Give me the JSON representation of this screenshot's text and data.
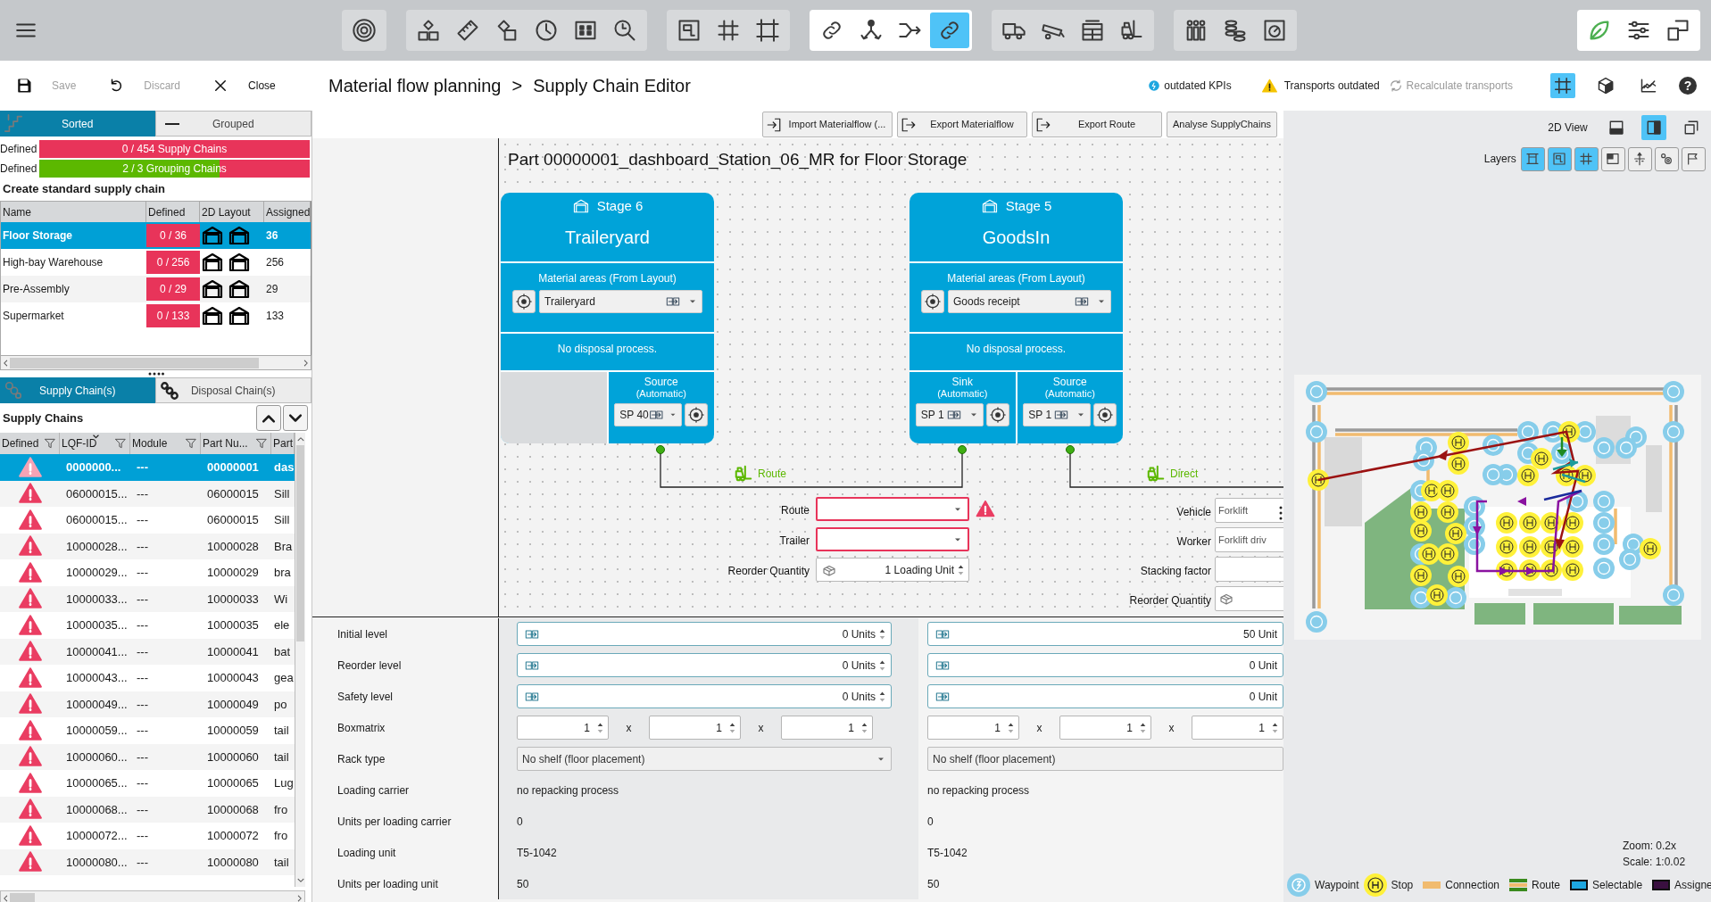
{
  "toolbar": {
    "groups": [
      {
        "highlighted": false,
        "icons": [
          {
            "selected": false
          }
        ]
      },
      {
        "highlighted": false,
        "icons": [
          {
            "selected": false
          },
          {
            "selected": false
          },
          {
            "selected": false
          },
          {
            "selected": false
          },
          {
            "selected": false
          },
          {
            "selected": false
          }
        ]
      },
      {
        "highlighted": false,
        "icons": [
          {
            "selected": false
          },
          {
            "selected": false
          },
          {
            "selected": false
          }
        ]
      },
      {
        "highlighted": true,
        "icons": [
          {
            "selected": false
          },
          {
            "selected": false
          },
          {
            "selected": false
          },
          {
            "selected": true
          }
        ]
      },
      {
        "highlighted": false,
        "icons": [
          {
            "selected": false
          },
          {
            "selected": false
          },
          {
            "selected": false
          },
          {
            "selected": false
          }
        ]
      },
      {
        "highlighted": false,
        "icons": [
          {
            "selected": false
          },
          {
            "selected": false
          },
          {
            "selected": false
          }
        ]
      },
      {
        "highlighted": true,
        "icons": [
          {
            "selected": false
          },
          {
            "selected": false
          },
          {
            "selected": false
          }
        ]
      }
    ]
  },
  "actions": [
    {
      "label": "Save",
      "disabled": true
    },
    {
      "label": "Discard",
      "disabled": true
    },
    {
      "label": "Close",
      "disabled": false
    }
  ],
  "breadcrumb": {
    "items": [
      "Material flow planning",
      "Supply Chain Editor"
    ],
    "separator": ">"
  },
  "status": {
    "kpis": "outdated KPIs",
    "transports": "Transports outdated",
    "recalculate": {
      "label": "Recalculate transports",
      "disabled": true
    }
  },
  "view_modes": [
    {
      "selected": true
    },
    {
      "selected": false
    },
    {
      "selected": false
    }
  ],
  "help": "?",
  "view_tabs": [
    {
      "label": "Sorted",
      "selected": true
    },
    {
      "label": "Grouped",
      "selected": false
    }
  ],
  "progress": [
    {
      "label": "Defined",
      "text": "0 / 454 Supply Chains",
      "level": 0
    },
    {
      "label": "Defined",
      "text": "2 / 3 Grouping Chains",
      "level": 0.667
    }
  ],
  "standard_heading": "Create standard supply chain",
  "standard_table": {
    "columns": [
      "Name",
      "Defined",
      "2D Layout",
      "Assigned"
    ],
    "rows": [
      {
        "name": "Floor Storage",
        "defined": "0 / 36",
        "assigned": "36",
        "selected": true
      },
      {
        "name": "High-bay Warehouse",
        "defined": "0 / 256",
        "assigned": "256",
        "selected": false
      },
      {
        "name": "Pre-Assembly",
        "defined": "0 / 29",
        "assigned": "29",
        "selected": false
      },
      {
        "name": "Supermarket",
        "defined": "0 / 133",
        "assigned": "133",
        "selected": false
      }
    ]
  },
  "chain_tabs": [
    {
      "label": "Supply Chain(s)",
      "selected": true
    },
    {
      "label": "Disposal Chain(s)",
      "selected": false
    }
  ],
  "chains_heading": "Supply Chains",
  "supply_table": {
    "columns": [
      {
        "label": "Defined",
        "filter": true,
        "sorted": false
      },
      {
        "label": "LQF-ID",
        "filter": true,
        "sorted": true
      },
      {
        "label": "Module",
        "filter": true,
        "sorted": false
      },
      {
        "label": "Part Nu...",
        "filter": true,
        "sorted": false
      },
      {
        "label": "Part"
      }
    ],
    "rows": [
      {
        "defined": false,
        "lqf_id": "0000000...",
        "module": "---",
        "part_number": "00000001",
        "part": "das",
        "selected": true
      },
      {
        "defined": false,
        "lqf_id": "06000015...",
        "module": "---",
        "part_number": "06000015",
        "part": "Sill",
        "selected": false
      },
      {
        "defined": false,
        "lqf_id": "06000015...",
        "module": "---",
        "part_number": "06000015",
        "part": "Sill",
        "selected": false
      },
      {
        "defined": false,
        "lqf_id": "10000028...",
        "module": "---",
        "part_number": "10000028",
        "part": "Bra",
        "selected": false
      },
      {
        "defined": false,
        "lqf_id": "10000029...",
        "module": "---",
        "part_number": "10000029",
        "part": "bra",
        "selected": false
      },
      {
        "defined": false,
        "lqf_id": "10000033...",
        "module": "---",
        "part_number": "10000033",
        "part": "Wi",
        "selected": false
      },
      {
        "defined": false,
        "lqf_id": "10000035...",
        "module": "---",
        "part_number": "10000035",
        "part": "ele",
        "selected": false
      },
      {
        "defined": false,
        "lqf_id": "10000041...",
        "module": "---",
        "part_number": "10000041",
        "part": "bat",
        "selected": false
      },
      {
        "defined": false,
        "lqf_id": "10000043...",
        "module": "---",
        "part_number": "10000043",
        "part": "gea",
        "selected": false
      },
      {
        "defined": false,
        "lqf_id": "10000049...",
        "module": "---",
        "part_number": "10000049",
        "part": "po",
        "selected": false
      },
      {
        "defined": false,
        "lqf_id": "10000059...",
        "module": "---",
        "part_number": "10000059",
        "part": "tail",
        "selected": false
      },
      {
        "defined": false,
        "lqf_id": "10000060...",
        "module": "---",
        "part_number": "10000060",
        "part": "tail",
        "selected": false
      },
      {
        "defined": false,
        "lqf_id": "10000065...",
        "module": "---",
        "part_number": "10000065",
        "part": "Lug",
        "selected": false
      },
      {
        "defined": false,
        "lqf_id": "10000068...",
        "module": "---",
        "part_number": "10000068",
        "part": "fro",
        "selected": false
      },
      {
        "defined": false,
        "lqf_id": "10000072...",
        "module": "---",
        "part_number": "10000072",
        "part": "fro",
        "selected": false
      },
      {
        "defined": false,
        "lqf_id": "10000080...",
        "module": "---",
        "part_number": "10000080",
        "part": "tail",
        "selected": false
      }
    ]
  },
  "editor_buttons": [
    "Import Materialflow (...",
    "Export Materialflow",
    "Export Route",
    "Analyse SupplyChains"
  ],
  "part_title": "Part 00000001_dashboard_Station_06_MR for Floor Storage",
  "stages": [
    {
      "stage": "Stage 6",
      "name": "Traileryard",
      "areas_label": "Material areas (From Layout)",
      "area": "Traileryard",
      "disposal": "No disposal process.",
      "points": [
        {
          "kind": "empty"
        },
        {
          "kind": "point",
          "type": "Source",
          "mode": "(Automatic)",
          "value": "SP 40"
        }
      ]
    },
    {
      "stage": "Stage 5",
      "name": "GoodsIn",
      "areas_label": "Material areas (From Layout)",
      "area": "Goods receipt",
      "disposal": "No disposal process.",
      "points": [
        {
          "kind": "point",
          "type": "Sink",
          "mode": "(Automatic)",
          "value": "SP 1"
        },
        {
          "kind": "point",
          "type": "Source",
          "mode": "(Automatic)",
          "value": "SP 1"
        }
      ]
    }
  ],
  "transports": [
    {
      "label": "Route"
    },
    {
      "label": "Direct"
    }
  ],
  "route_form": [
    {
      "label": "Route",
      "kind": "select",
      "error": true,
      "warning": true
    },
    {
      "label": "Trailer",
      "kind": "select",
      "error": true,
      "warning": false
    },
    {
      "label": "Reorder Quantity",
      "kind": "quantity",
      "value": "1 Loading Unit",
      "error": false,
      "warning": false
    }
  ],
  "vehicle_form": [
    {
      "label": "Vehicle",
      "kind": "text",
      "value": "Forklift"
    },
    {
      "label": "Worker",
      "kind": "text",
      "value": "Forklift driv"
    },
    {
      "label": "Stacking factor",
      "kind": "text"
    },
    {
      "label": "Reorder Quantity",
      "kind": "quantity"
    }
  ],
  "properties": [
    {
      "label": "Initial level",
      "kind": "units",
      "values": [
        "0 Units",
        "50 Unit"
      ]
    },
    {
      "label": "Reorder level",
      "kind": "units",
      "values": [
        "0 Units",
        "0 Unit"
      ]
    },
    {
      "label": "Safety level",
      "kind": "units",
      "values": [
        "0 Units",
        "0 Unit"
      ]
    },
    {
      "label": "Boxmatrix",
      "kind": "matrix",
      "values": [
        {
          "cells": [
            "1",
            "1",
            "1"
          ],
          "separators": [
            "x",
            "x"
          ]
        },
        {
          "cells": [
            "1",
            "1",
            "1"
          ],
          "separators": [
            "x",
            "x"
          ]
        }
      ]
    },
    {
      "label": "Rack type",
      "kind": "select",
      "values": [
        "No shelf (floor placement)",
        "No shelf (floor placement)"
      ]
    },
    {
      "label": "Loading carrier",
      "kind": "text",
      "values": [
        "no repacking process",
        "no repacking process"
      ]
    },
    {
      "label": "Units per loading carrier",
      "kind": "text",
      "values": [
        "0",
        "0"
      ]
    },
    {
      "label": "Loading unit",
      "kind": "text",
      "values": [
        "T5-1042",
        "T5-1042"
      ]
    },
    {
      "label": "Units per loading unit",
      "kind": "text",
      "values": [
        "50",
        "50"
      ]
    }
  ],
  "view": {
    "label": "2D View",
    "buttons": [
      {
        "selected": false
      },
      {
        "selected": true
      },
      {
        "selected": false
      }
    ]
  },
  "layers": {
    "label": "Layers",
    "buttons": [
      {
        "on": true
      },
      {
        "on": true
      },
      {
        "on": true
      },
      {
        "on": false
      },
      {
        "on": false
      },
      {
        "on": false
      },
      {
        "on": false
      }
    ]
  },
  "map": {
    "zoom": "Zoom: 0.2x",
    "scale": "Scale: 1:0.02"
  },
  "legend": [
    {
      "kind": "waypoint",
      "label": "Waypoint"
    },
    {
      "kind": "stop",
      "label": "Stop"
    },
    {
      "kind": "connection",
      "label": "Connection"
    },
    {
      "kind": "route",
      "label": "Route"
    },
    {
      "kind": "selectable",
      "label": "Selectable"
    },
    {
      "kind": "assigned",
      "label": "Assigne"
    }
  ]
}
